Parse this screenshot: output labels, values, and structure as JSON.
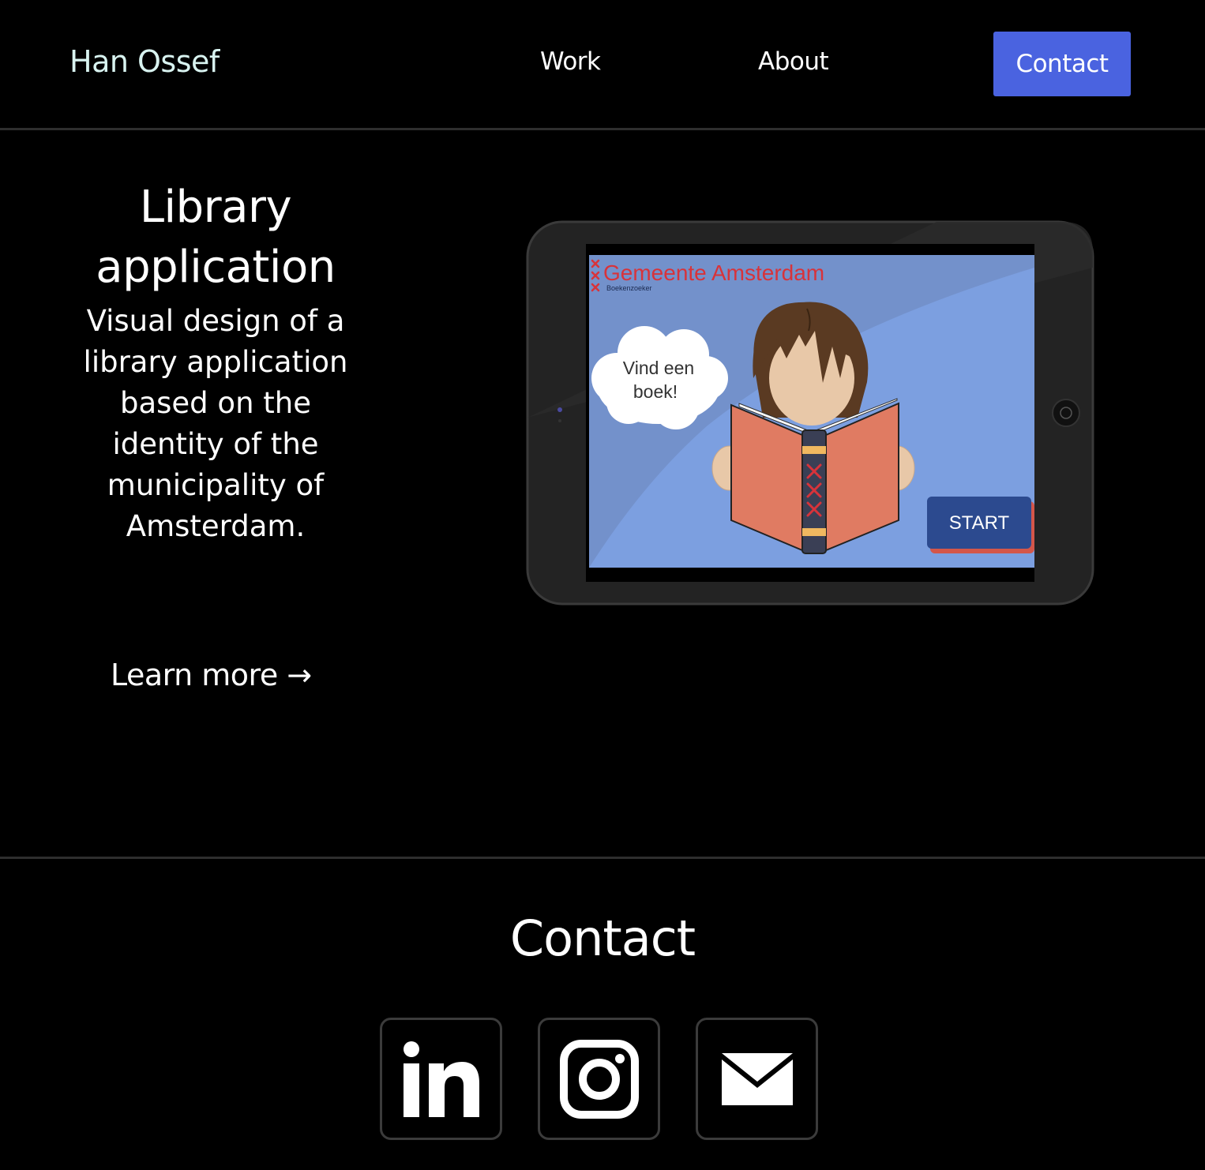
{
  "header": {
    "logo": "Han Ossef",
    "nav": {
      "work": "Work",
      "about": "About",
      "contact": "Contact"
    }
  },
  "project": {
    "title": "Library application",
    "description": "Visual design of a library application based on the identity of the municipality of Amsterdam.",
    "learn_more": "Learn more →",
    "mockup": {
      "brand": "Gemeente Amsterdam",
      "subbrand": "Boekenzoeker",
      "speech": [
        "Vind een",
        "boek!"
      ],
      "start_button": "START"
    }
  },
  "contact": {
    "heading": "Contact",
    "links": [
      {
        "icon": "linkedin-icon"
      },
      {
        "icon": "instagram-icon"
      },
      {
        "icon": "email-icon"
      }
    ]
  },
  "colors": {
    "accent": "#4a63e0",
    "background": "#000000",
    "logo": "#d8f3f0",
    "amsterdam_red": "#d8333a",
    "book": "#e07b62",
    "screen_blue": "#7c9fe0",
    "start_button": "#2c4a8f"
  }
}
